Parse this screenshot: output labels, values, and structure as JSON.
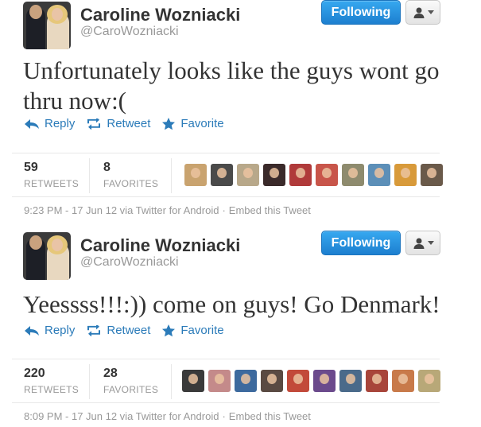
{
  "tweets": [
    {
      "display_name": "Caroline Wozniacki",
      "screen_name": "@CaroWozniacki",
      "follow_label": "Following",
      "text": "Unfortunately looks like the guys wont go thru now:(",
      "actions": {
        "reply": "Reply",
        "retweet": "Retweet",
        "favorite": "Favorite"
      },
      "retweets": {
        "count": "59",
        "label": "RETWEETS"
      },
      "favorites": {
        "count": "8",
        "label": "FAVORITES"
      },
      "faces": [
        "#c9a36f",
        "#4a4a4a",
        "#b8a88a",
        "#3a2a2a",
        "#b03a3a",
        "#c8554a",
        "#8e8b6e",
        "#5c8fb8",
        "#d89a3a",
        "#6a5a4a"
      ],
      "timestamp": "9:23 PM - 17 Jun 12 via Twitter for Android",
      "embed_label": "Embed this Tweet"
    },
    {
      "display_name": "Caroline Wozniacki",
      "screen_name": "@CaroWozniacki",
      "follow_label": "Following",
      "text": "Yeessss!!!:)) come on guys! Go Denmark!",
      "actions": {
        "reply": "Reply",
        "retweet": "Retweet",
        "favorite": "Favorite"
      },
      "retweets": {
        "count": "220",
        "label": "RETWEETS"
      },
      "favorites": {
        "count": "28",
        "label": "FAVORITES"
      },
      "faces": [
        "#3a3a3a",
        "#c48a8a",
        "#3d6a9e",
        "#5a4a42",
        "#c24a3a",
        "#6b4a8c",
        "#4a6a8a",
        "#a8453a",
        "#c87a4a",
        "#b8a878"
      ],
      "timestamp": "8:09 PM - 17 Jun 12 via Twitter for Android",
      "embed_label": "Embed this Tweet"
    }
  ],
  "colors": {
    "link": "#2b7bb9",
    "follow_button": "#2b90d9",
    "muted": "#999999"
  },
  "icons": {
    "reply": "reply-arrow-icon",
    "retweet": "retweet-icon",
    "favorite": "star-icon",
    "user_menu": "person-icon"
  }
}
